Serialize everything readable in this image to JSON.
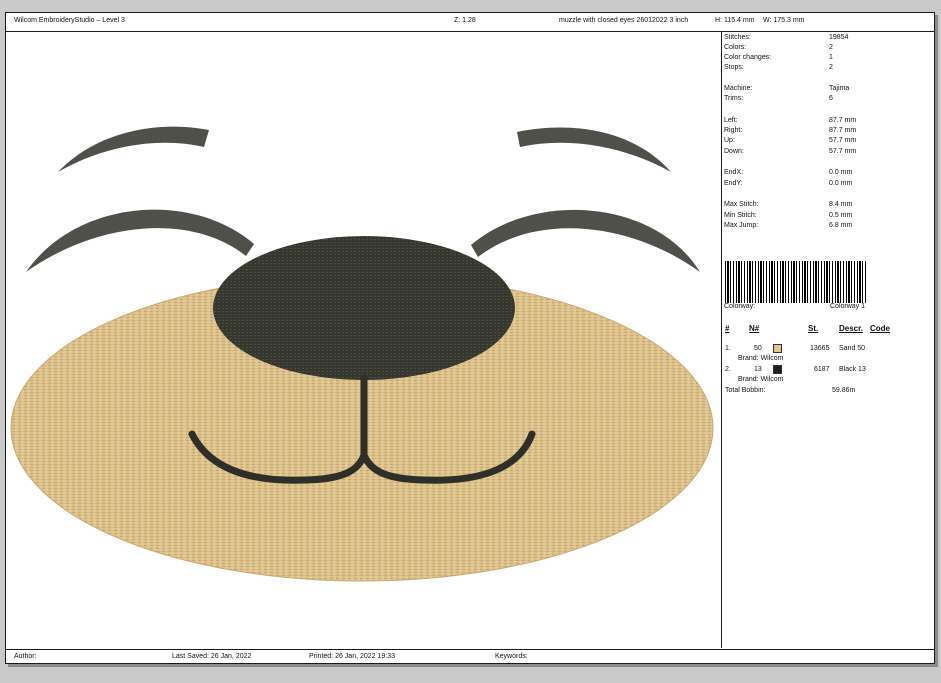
{
  "header": {
    "app_title": "Wilcom EmbroideryStudio – Level 3",
    "zoom": "Z: 1.28",
    "design_name": "muzzle with closed eyes 26012022 3 inch",
    "height": "H: 115.4 mm",
    "width": "W: 175.3 mm"
  },
  "stats": [
    {
      "label": "Stitches:",
      "value": "19854"
    },
    {
      "label": "Colors:",
      "value": "2"
    },
    {
      "label": "Color changes:",
      "value": "1"
    },
    {
      "label": "Stops:",
      "value": "2"
    },
    {
      "label": "Machine:",
      "value": "Tajima"
    },
    {
      "label": "Trims:",
      "value": "6"
    },
    {
      "label": "Left:",
      "value": "87.7 mm"
    },
    {
      "label": "Right:",
      "value": "87.7 mm"
    },
    {
      "label": "Up:",
      "value": "57.7 mm"
    },
    {
      "label": "Down:",
      "value": "57.7 mm"
    },
    {
      "label": "EndX:",
      "value": "0.0 mm"
    },
    {
      "label": "EndY:",
      "value": "0.0 mm"
    },
    {
      "label": "Max Stitch:",
      "value": "8.4 mm"
    },
    {
      "label": "Min Stitch:",
      "value": "0.5 mm"
    },
    {
      "label": "Max Jump:",
      "value": "6.8 mm"
    }
  ],
  "colorway": {
    "label": "Colorway:",
    "value": "Colorway 1"
  },
  "color_table": {
    "headers": [
      "#",
      "N#",
      "St.",
      "Descr.",
      "Code"
    ],
    "rows": [
      {
        "index": "1.",
        "number": "50",
        "color": "#e8c48e",
        "stitches": "13665",
        "description": "Sand 50",
        "brand": "Brand: Wilcom"
      },
      {
        "index": "2.",
        "number": "13",
        "color": "#1f1f1f",
        "stitches": "6187",
        "description": "Black 13",
        "brand": "Brand: Wilcom"
      }
    ],
    "total_bobbin_label": "Total Bobbin:",
    "total_bobbin_value": "59.86m"
  },
  "footer": {
    "author": "Author:",
    "last_saved": "Last Saved: 26 Jan, 2022",
    "printed": "Printed: 26 Jan, 2022 19:33",
    "keywords": "Keywords:"
  },
  "colors": {
    "sand": "#d9bd83",
    "sand_dark": "#b89a62",
    "black_thread": "#3a3a33",
    "eyebrow": "#5b5c52"
  }
}
